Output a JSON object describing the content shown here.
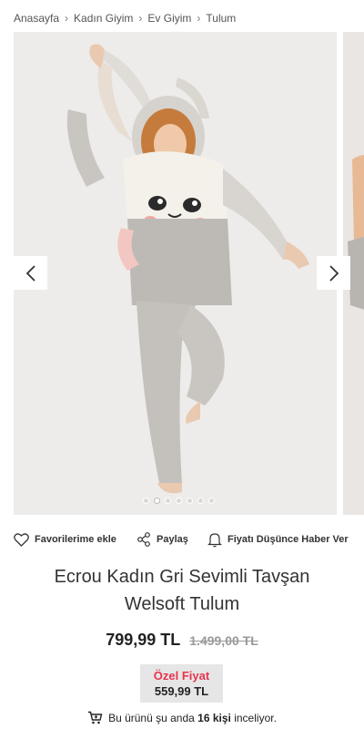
{
  "breadcrumb": [
    "Anasayfa",
    "Kadın Giyim",
    "Ev Giyim",
    "Tulum"
  ],
  "gallery": {
    "slide_count": 7,
    "active_slide": 2,
    "main_image": "woman-in-bunny-onesie-photo",
    "next_image": "next-product-photo-partial"
  },
  "actions": {
    "favorite": "Favorilerime ekle",
    "share": "Paylaş",
    "price_alert": "Fiyatı Düşünce Haber Ver"
  },
  "product": {
    "title_line1": "Ecrou Kadın Gri Sevimli Tavşan",
    "title_line2": "Welsoft Tulum"
  },
  "price": {
    "current": "799,99 TL",
    "old": "1.499,00 TL"
  },
  "special_price": {
    "label": "Özel Fiyat",
    "value": "559,99 TL"
  },
  "viewing": {
    "prefix": "Bu ürünü şu anda",
    "count": "16 kişi",
    "suffix": "inceliyor."
  },
  "colors": {
    "accent_red": "#e8344f",
    "text_dark": "#222222",
    "special_bg": "#e6e6e6"
  }
}
